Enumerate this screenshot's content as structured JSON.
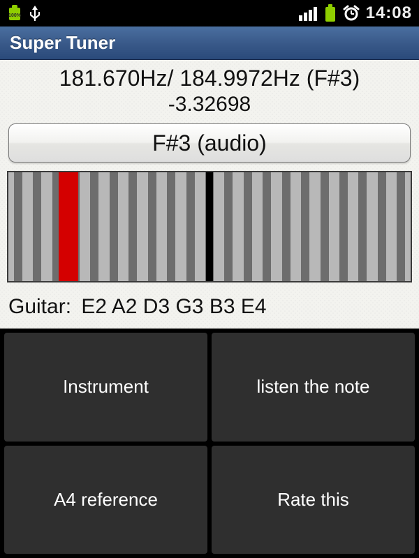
{
  "status": {
    "battery_pct": "100%",
    "time": "14:08"
  },
  "title": "Super Tuner",
  "tuner": {
    "measured_hz": "181.670Hz",
    "target_hz": "184.9972Hz",
    "target_note": "F#3",
    "cents_offset": "-3.32698",
    "play_label": "F#3 (audio)",
    "meter": {
      "position_pct": 15
    },
    "instrument_label": "Guitar:",
    "strings": [
      "E2",
      "A2",
      "D3",
      "G3",
      "B3",
      "E4"
    ]
  },
  "menu": {
    "instrument": "Instrument",
    "listen": "listen the note",
    "a4ref": "A4 reference",
    "rate": "Rate this"
  }
}
